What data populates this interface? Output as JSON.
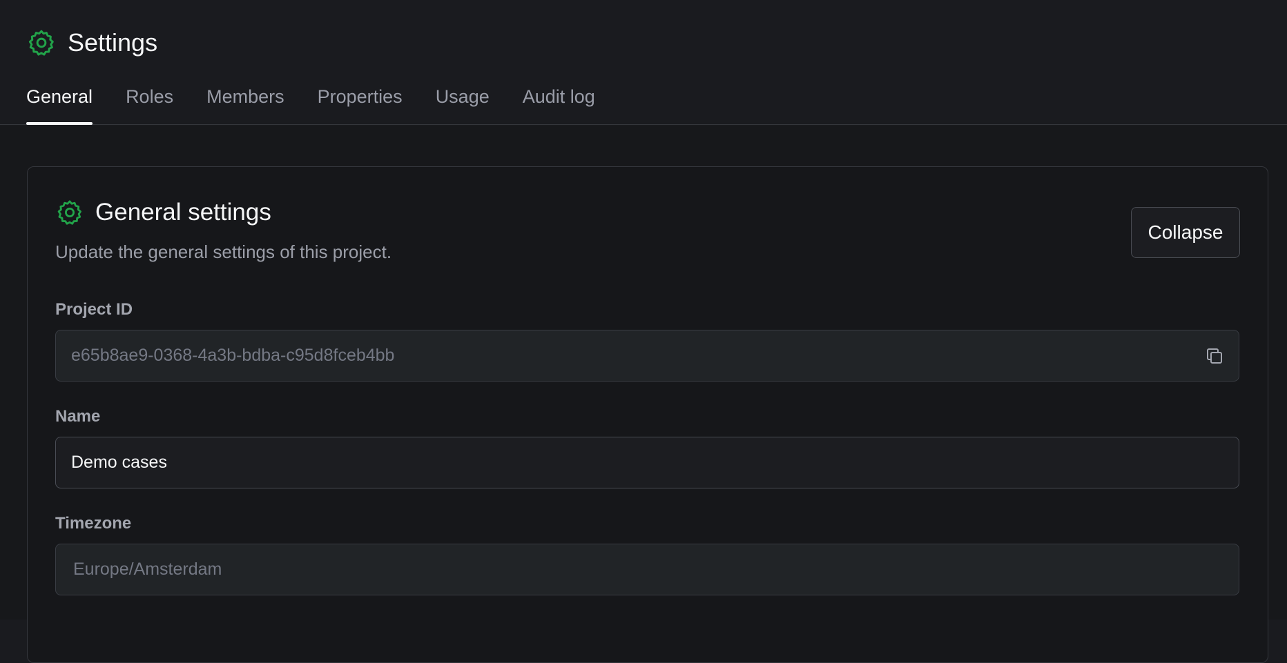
{
  "header": {
    "title": "Settings",
    "icon": "gear-icon",
    "tabs": [
      {
        "label": "General",
        "active": true
      },
      {
        "label": "Roles",
        "active": false
      },
      {
        "label": "Members",
        "active": false
      },
      {
        "label": "Properties",
        "active": false
      },
      {
        "label": "Usage",
        "active": false
      },
      {
        "label": "Audit log",
        "active": false
      }
    ]
  },
  "card": {
    "title": "General settings",
    "description": "Update the general settings of this project.",
    "collapse_label": "Collapse",
    "icon": "gear-icon",
    "fields": {
      "project_id": {
        "label": "Project ID",
        "value": "e65b8ae9-0368-4a3b-bdba-c95d8fceb4bb",
        "icon": "copy-icon"
      },
      "name": {
        "label": "Name",
        "value": "Demo cases"
      },
      "timezone": {
        "label": "Timezone",
        "value": "Europe/Amsterdam"
      }
    }
  },
  "colors": {
    "accent": "#22a44a",
    "background": "#1a1b1f",
    "text": "#f5f6f7",
    "muted": "#9a9da8"
  }
}
